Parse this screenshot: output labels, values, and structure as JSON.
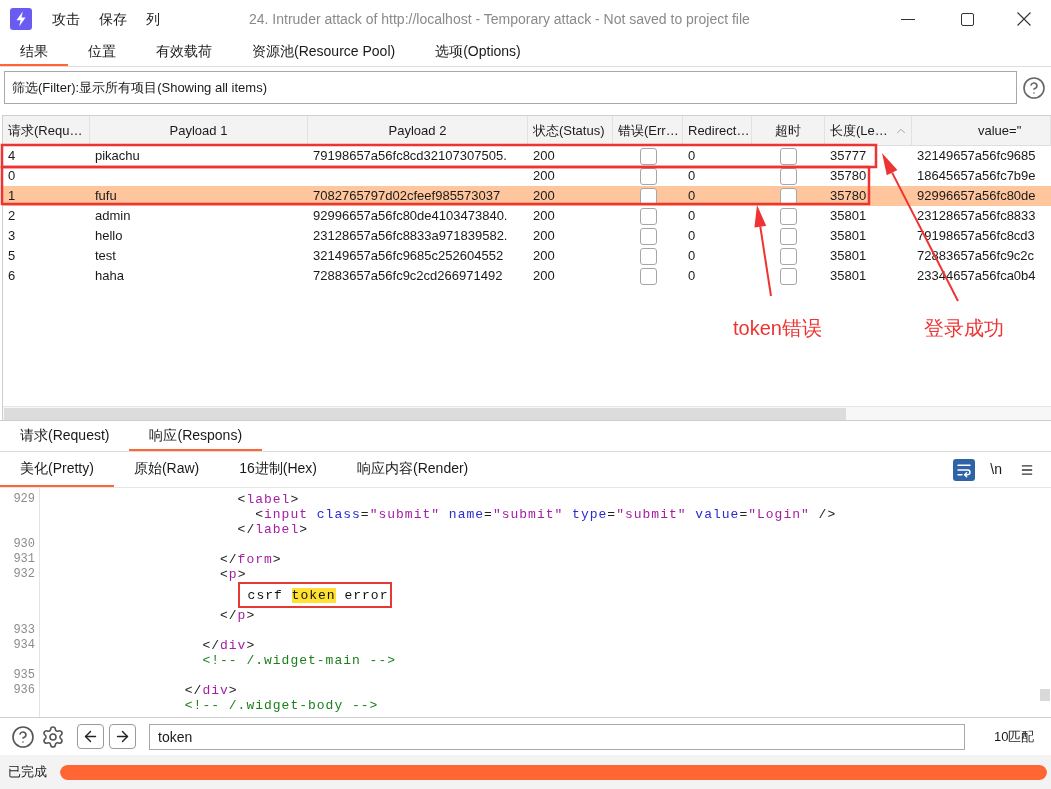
{
  "window": {
    "title": "24. Intruder attack of http://localhost - Temporary attack - Not saved to project file",
    "menu": [
      "攻击",
      "保存",
      "列"
    ]
  },
  "tabs": [
    {
      "label": "结果",
      "selected": true
    },
    {
      "label": "位置",
      "selected": false
    },
    {
      "label": "有效载荷",
      "selected": false
    },
    {
      "label": "资源池(Resource Pool)",
      "selected": false
    },
    {
      "label": "选项(Options)",
      "selected": false
    }
  ],
  "filter": {
    "value": "筛选(Filter):显示所有项目(Showing all items)"
  },
  "table": {
    "columns": [
      {
        "label": "请求(Requ…",
        "sorted": false
      },
      {
        "label": "Payload 1",
        "sorted": false
      },
      {
        "label": "Payload 2",
        "sorted": false
      },
      {
        "label": "状态(Status)",
        "sorted": false
      },
      {
        "label": "错误(Err…",
        "sorted": false
      },
      {
        "label": "Redirect…",
        "sorted": false
      },
      {
        "label": "超时",
        "sorted": false
      },
      {
        "label": "长度(Le…",
        "sorted": true
      },
      {
        "label": "value=\"",
        "sorted": false
      }
    ],
    "rows": [
      {
        "request": "4",
        "payload_1": "pikachu",
        "payload_2": "79198657a56fc8cd32107307505.",
        "status": "200",
        "error": false,
        "redirects": "0",
        "timeout": false,
        "length": "35777",
        "value": "32149657a56fc9685",
        "selected": false
      },
      {
        "request": "0",
        "status": "200",
        "error": false,
        "redirects": "0",
        "timeout": false,
        "length": "35780",
        "value": "18645657a56fc7b9e",
        "selected": false
      },
      {
        "request": "1",
        "payload_1": "fufu",
        "payload_2": "7082765797d02cfeef985573037",
        "status": "200",
        "error": false,
        "redirects": "0",
        "timeout": false,
        "length": "35780",
        "value": "92996657a56fc80de",
        "selected": true
      },
      {
        "request": "2",
        "payload_1": "admin",
        "payload_2": "92996657a56fc80de4103473840.",
        "status": "200",
        "error": false,
        "redirects": "0",
        "timeout": false,
        "length": "35801",
        "value": "23128657a56fc8833",
        "selected": false
      },
      {
        "request": "3",
        "payload_1": "hello",
        "payload_2": "23128657a56fc8833a971839582.",
        "status": "200",
        "error": false,
        "redirects": "0",
        "timeout": false,
        "length": "35801",
        "value": "79198657a56fc8cd3",
        "selected": false
      },
      {
        "request": "5",
        "payload_1": "test",
        "payload_2": "32149657a56fc9685c252604552",
        "status": "200",
        "error": false,
        "redirects": "0",
        "timeout": false,
        "length": "35801",
        "value": "72883657a56fc9c2c",
        "selected": false
      },
      {
        "request": "6",
        "payload_1": "haha",
        "payload_2": "72883657a56fc9c2cd266971492",
        "status": "200",
        "error": false,
        "redirects": "0",
        "timeout": false,
        "length": "35801",
        "value": "23344657a56fca0b4",
        "selected": false
      }
    ]
  },
  "annotations": [
    {
      "text": "token错误"
    },
    {
      "text": "登录成功"
    }
  ],
  "response": {
    "message_tabs": [
      {
        "label": "请求(Request)",
        "selected": false
      },
      {
        "label": "响应(Respons)",
        "selected": true
      }
    ],
    "view_tabs": [
      {
        "label": "美化(Pretty)",
        "selected": true
      },
      {
        "label": "原始(Raw)",
        "selected": false
      },
      {
        "label": "16进制(Hex)",
        "selected": false
      },
      {
        "label": "响应内容(Render)",
        "selected": false
      }
    ],
    "toolbar": {
      "wrap_on": true,
      "newline": "\\n"
    },
    "lines": [
      {
        "number": "929",
        "annotated": false,
        "segments": [
          {
            "kind": "punct",
            "text": "<"
          },
          {
            "kind": "tag",
            "text": "label"
          },
          {
            "kind": "punct",
            "text": ">"
          }
        ]
      },
      {
        "annotated": false,
        "segments": [
          {
            "kind": "punct",
            "text": "<"
          },
          {
            "kind": "tag",
            "text": "input"
          },
          {
            "kind": "attr",
            "text": " class"
          },
          {
            "kind": "punct",
            "text": "="
          },
          {
            "kind": "value",
            "text": "\"submit\""
          },
          {
            "kind": "attr",
            "text": " name"
          },
          {
            "kind": "punct",
            "text": "="
          },
          {
            "kind": "value",
            "text": "\"submit\""
          },
          {
            "kind": "attr",
            "text": " type"
          },
          {
            "kind": "punct",
            "text": "="
          },
          {
            "kind": "value",
            "text": "\"submit\""
          },
          {
            "kind": "attr",
            "text": " value"
          },
          {
            "kind": "punct",
            "text": "="
          },
          {
            "kind": "value",
            "text": "\"Login\""
          },
          {
            "kind": "punct",
            "text": " />"
          }
        ]
      },
      {
        "annotated": false,
        "segments": [
          {
            "kind": "punct",
            "text": "</"
          },
          {
            "kind": "tag",
            "text": "label"
          },
          {
            "kind": "punct",
            "text": ">"
          }
        ]
      },
      {
        "number": "930",
        "annotated": false
      },
      {
        "number": "931",
        "annotated": false,
        "segments": [
          {
            "kind": "punct",
            "text": "</"
          },
          {
            "kind": "tag",
            "text": "form"
          },
          {
            "kind": "punct",
            "text": ">"
          }
        ]
      },
      {
        "number": "932",
        "annotated": false,
        "segments": [
          {
            "kind": "punct",
            "text": "<"
          },
          {
            "kind": "tag",
            "text": "p"
          },
          {
            "kind": "punct",
            "text": ">"
          }
        ]
      },
      {
        "annotated": true,
        "segments": [
          {
            "kind": "text",
            "text": "csrf "
          },
          {
            "kind": "match",
            "text": "token"
          },
          {
            "kind": "text",
            "text": " error"
          }
        ]
      },
      {
        "annotated": false,
        "segments": [
          {
            "kind": "punct",
            "text": "</"
          },
          {
            "kind": "tag",
            "text": "p"
          },
          {
            "kind": "punct",
            "text": ">"
          }
        ]
      },
      {
        "number": "933",
        "annotated": false
      },
      {
        "number": "934",
        "annotated": false,
        "segments": [
          {
            "kind": "punct",
            "text": "</"
          },
          {
            "kind": "tag",
            "text": "div"
          },
          {
            "kind": "punct",
            "text": ">"
          }
        ]
      },
      {
        "annotated": false,
        "segments": [
          {
            "kind": "comment",
            "text": "<!-- /.widget-main -->"
          }
        ]
      },
      {
        "number": "935",
        "annotated": false
      },
      {
        "number": "936",
        "annotated": false,
        "segments": [
          {
            "kind": "punct",
            "text": "</"
          },
          {
            "kind": "tag",
            "text": "div"
          },
          {
            "kind": "punct",
            "text": ">"
          }
        ]
      },
      {
        "annotated": false,
        "segments": [
          {
            "kind": "comment",
            "text": "<!-- /.widget-body -->"
          }
        ]
      }
    ]
  },
  "search": {
    "value": "token",
    "matches": "10匹配"
  },
  "status_bar": {
    "text": "已完成",
    "progress": {
      "level": 1
    }
  }
}
